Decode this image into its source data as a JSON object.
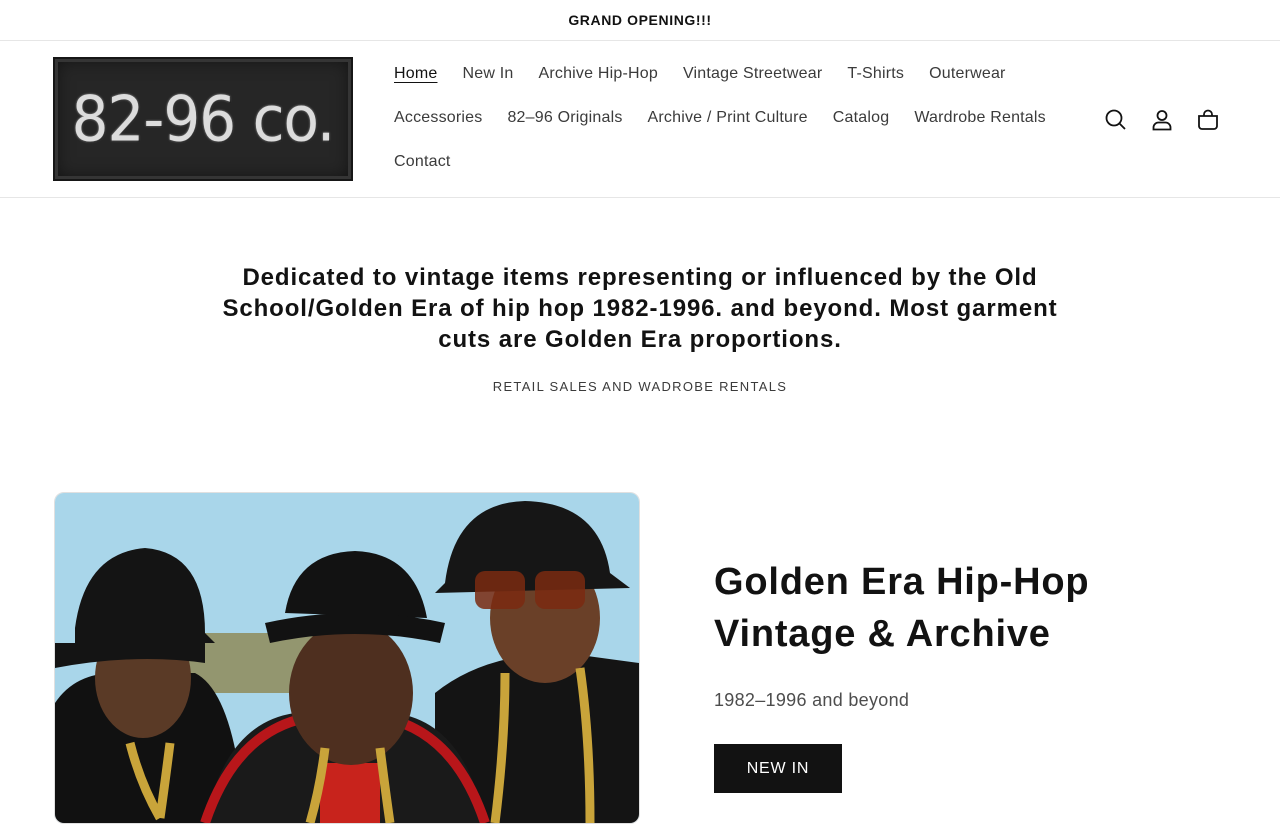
{
  "announcement": "GRAND OPENING!!!",
  "logo": {
    "text": "82-96 co."
  },
  "nav": {
    "row1": [
      "Home",
      "New In",
      "Archive Hip-Hop",
      "Vintage Streetwear",
      "T-Shirts",
      "Outerwear"
    ],
    "row2": [
      "Accessories",
      "82–96 Originals",
      "Archive / Print Culture",
      "Catalog",
      "Wardrobe Rentals"
    ],
    "row3": [
      "Contact"
    ],
    "active": "Home"
  },
  "header_icons": [
    "search-icon",
    "account-icon",
    "cart-icon"
  ],
  "intro": {
    "heading": "Dedicated to vintage items representing or influenced by the Old School/Golden Era of hip hop 1982-1996. and beyond. Most garment cuts are Golden Era proportions.",
    "subheading": "RETAIL SALES AND WADROBE RENTALS"
  },
  "hero": {
    "image": "photo of three men in black hats, gold chains and black leather jackets",
    "title_line1": "Golden Era Hip-Hop",
    "title_line2": "Vintage & Archive",
    "subtitle": "1982–1996 and beyond",
    "button": "NEW IN"
  },
  "colors": {
    "text": "#121212",
    "button_bg": "#121212",
    "button_text": "#ffffff",
    "sky": "#a9d6ea"
  }
}
